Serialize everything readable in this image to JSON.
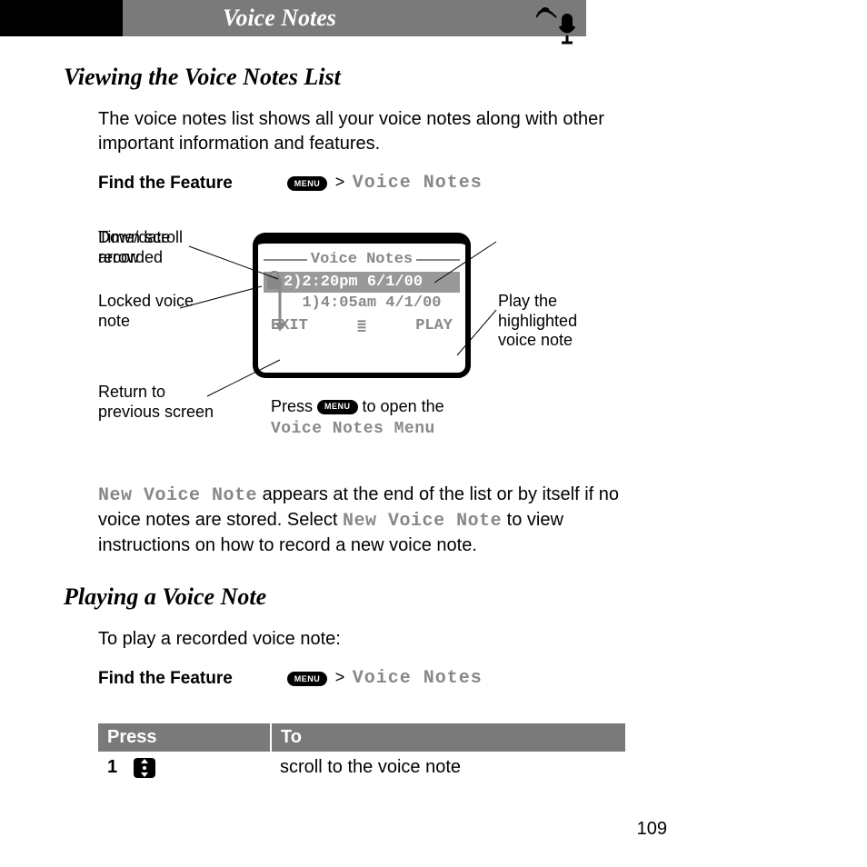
{
  "header": {
    "title": "Voice Notes"
  },
  "section1": {
    "heading": "Viewing the Voice Notes List",
    "intro": "The voice notes list shows all your voice notes along with other important information and features.",
    "findFeature": "Find the Feature",
    "menuKey": "MENU",
    "path": "Voice Notes"
  },
  "screen": {
    "title": "Voice Notes",
    "row1": "2)2:20pm 6/1/00",
    "row2": "1)4:05am 4/1/00",
    "left": "EXIT",
    "right": "PLAY"
  },
  "callouts": {
    "downScroll": "Down scroll arrow",
    "locked": "Locked voice note",
    "returnPrev": "Return to previous screen",
    "timeDate": "Time/date recorded",
    "playHighlighted": "Play the highlighted voice note",
    "pressPrefix": "Press ",
    "pressSuffix": " to open the",
    "menuLabel": "Voice Notes Menu"
  },
  "paragraph2": {
    "p1a": "New Voice Note",
    "p1b": " appears at the end of the list or by itself if no voice notes are stored. Select ",
    "p1c": "New Voice Note",
    "p1d": " to view instructions on how to record a new voice note."
  },
  "section2": {
    "heading": "Playing a Voice Note",
    "intro": "To play a recorded voice note:",
    "findFeature": "Find the Feature",
    "path": "Voice Notes"
  },
  "table": {
    "col1": "Press",
    "col2": "To",
    "step": "1",
    "desc": "scroll to the voice note"
  },
  "pageNumber": "109"
}
